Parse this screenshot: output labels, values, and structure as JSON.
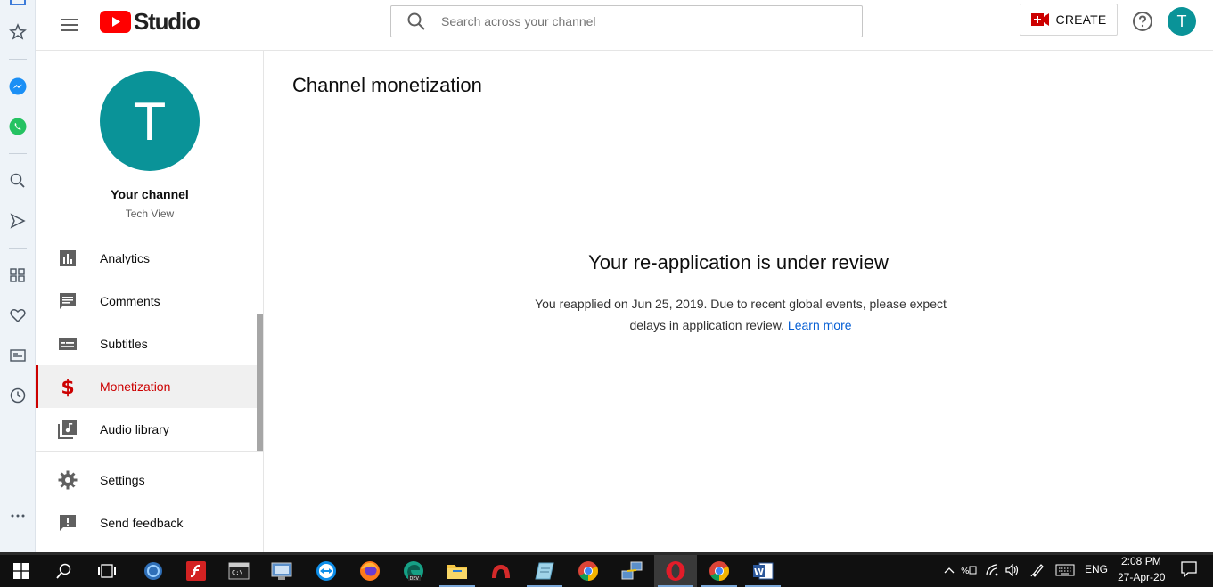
{
  "app": {
    "logo_text": "Studio",
    "brand_color": "#ff0000",
    "accent_color": "#cc0000",
    "avatar_color": "#0a9398"
  },
  "header": {
    "search_placeholder": "Search across your channel",
    "create_label": "CREATE",
    "avatar_letter": "T"
  },
  "sidebar": {
    "channel_avatar_letter": "T",
    "channel_title": "Your channel",
    "channel_name": "Tech View",
    "items": [
      {
        "label": "Analytics",
        "icon": "analytics-icon"
      },
      {
        "label": "Comments",
        "icon": "comments-icon"
      },
      {
        "label": "Subtitles",
        "icon": "subtitles-icon"
      },
      {
        "label": "Monetization",
        "icon": "dollar-icon",
        "active": true
      },
      {
        "label": "Audio library",
        "icon": "audio-library-icon"
      }
    ],
    "footer_items": [
      {
        "label": "Settings",
        "icon": "gear-icon"
      },
      {
        "label": "Send feedback",
        "icon": "feedback-icon"
      }
    ]
  },
  "main": {
    "page_title": "Channel monetization",
    "review_title": "Your re-application is under review",
    "review_body": "You reapplied on Jun 25, 2019. Due to recent global events, please expect delays in application review.",
    "learn_more": "Learn more"
  },
  "taskbar": {
    "language": "ENG",
    "time": "2:08 PM",
    "date": "27-Apr-20"
  }
}
